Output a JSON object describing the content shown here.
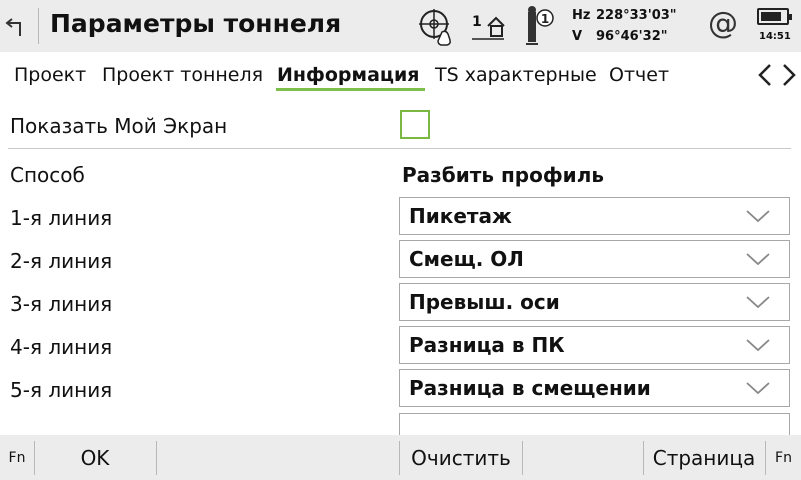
{
  "header": {
    "title": "Параметры тоннеля",
    "face_indicator": "1",
    "person_indicator": "1",
    "hz_label": "Hz",
    "hz_value": "228°33'03\"",
    "v_label": "V",
    "v_value": "96°46'32\"",
    "time": "14:51",
    "battery_level": 0.85,
    "icons": [
      "back-arrow-icon",
      "target-hand-icon",
      "telescope-face-icon",
      "person-mode-icon",
      "at-icon",
      "battery-icon"
    ]
  },
  "tabs": [
    {
      "label": "Проект",
      "active": false
    },
    {
      "label": "Проект тоннеля",
      "active": false
    },
    {
      "label": "Информация",
      "active": true
    },
    {
      "label": "TS характерные",
      "active": false
    },
    {
      "label": "Отчет",
      "active": false
    }
  ],
  "form": {
    "show_my_screen_label": "Показать Мой Экран",
    "show_my_screen_checked": false,
    "method_label": "Способ",
    "method_value": "Разбить профиль",
    "lines": [
      {
        "label": "1-я линия",
        "value": "Пикетаж"
      },
      {
        "label": "2-я линия",
        "value": "Смещ. ОЛ"
      },
      {
        "label": "3-я линия",
        "value": "Превыш. оси"
      },
      {
        "label": "4-я линия",
        "value": "Разница в ПК"
      },
      {
        "label": "5-я линия",
        "value": "Разница в смещении"
      }
    ]
  },
  "softkeys": {
    "fn_left": "Fn",
    "ok": "OK",
    "clear": "Очистить",
    "page": "Страница",
    "fn_right": "Fn"
  },
  "colors": {
    "accent_green": "#7cbf4a",
    "bar_background": "#ececec"
  }
}
